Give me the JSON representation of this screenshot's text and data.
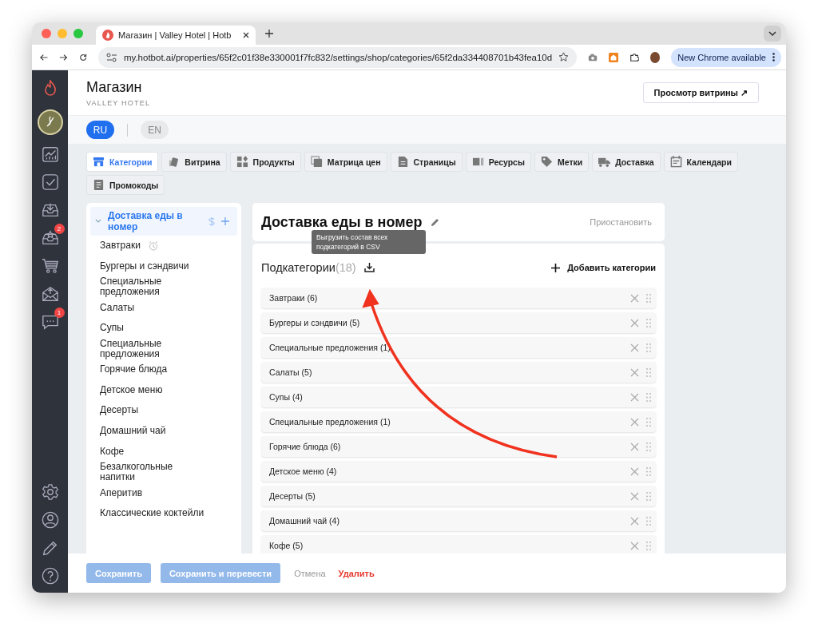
{
  "browser": {
    "tab_title": "Магазин | Valley Hotel | Hotb",
    "url": "my.hotbot.ai/properties/65f2c01f38e330001f7fc832/settings/shop/categories/65f2da334408701b43fea10d",
    "update_button": "New Chrome available"
  },
  "sidebar": {
    "inbox_badge": "2",
    "chat_badge": "1"
  },
  "header": {
    "title": "Магазин",
    "subtitle": "VALLEY HOTEL",
    "preview_button": "Просмотр витрины ↗"
  },
  "languages": [
    {
      "label": "RU",
      "selected": true
    },
    {
      "label": "EN",
      "selected": false
    }
  ],
  "tabs": [
    {
      "label": "Категории",
      "selected": true
    },
    {
      "label": "Витрина",
      "selected": false
    },
    {
      "label": "Продукты",
      "selected": false
    },
    {
      "label": "Матрица цен",
      "selected": false
    },
    {
      "label": "Страницы",
      "selected": false
    },
    {
      "label": "Ресурсы",
      "selected": false
    },
    {
      "label": "Метки",
      "selected": false
    },
    {
      "label": "Доставка",
      "selected": false
    },
    {
      "label": "Календари",
      "selected": false
    },
    {
      "label": "Промокоды",
      "selected": false
    }
  ],
  "category_tree": {
    "label": "Доставка еды в номер",
    "expanded": true,
    "selected": true,
    "children": [
      {
        "label": "Завтраки",
        "scheduled": true
      },
      {
        "label": "Бургеры и сэндвичи",
        "scheduled": false
      },
      {
        "label": "Специальные предложения",
        "scheduled": false
      },
      {
        "label": "Салаты",
        "scheduled": false
      },
      {
        "label": "Супы",
        "scheduled": false
      },
      {
        "label": "Специальные предложения",
        "scheduled": false
      },
      {
        "label": "Горячие блюда",
        "scheduled": false
      },
      {
        "label": "Детское меню",
        "scheduled": false
      },
      {
        "label": "Десерты",
        "scheduled": false
      },
      {
        "label": "Домашний чай",
        "scheduled": false
      },
      {
        "label": "Кофе",
        "scheduled": false
      },
      {
        "label": "Безалкогольные напитки",
        "scheduled": false
      },
      {
        "label": "Аперитив",
        "scheduled": false
      },
      {
        "label": "Классические коктейли",
        "scheduled": false
      }
    ]
  },
  "detail": {
    "title": "Доставка еды в номер",
    "pause_link": "Приостановить",
    "tooltip": "Выгрузить состав всех подкатегорий в CSV",
    "subcategories_title": "Подкатегории",
    "subcategories_count": "(18)",
    "add_button": "Добавить категории",
    "subcategories": [
      "Завтраки (6)",
      "Бургеры и сэндвичи (5)",
      "Специальные предложения (1)",
      "Салаты (5)",
      "Супы (4)",
      "Специальные предложения (1)",
      "Горячие блюда (6)",
      "Детское меню (4)",
      "Десерты (5)",
      "Домашний чай (4)",
      "Кофе (5)"
    ]
  },
  "footer": {
    "save": {
      "label": "Сохранить",
      "disabled": true
    },
    "save_translate": {
      "label": "Сохранить и перевести",
      "disabled": true
    },
    "cancel": "Отмена",
    "delete": "Удалить"
  }
}
